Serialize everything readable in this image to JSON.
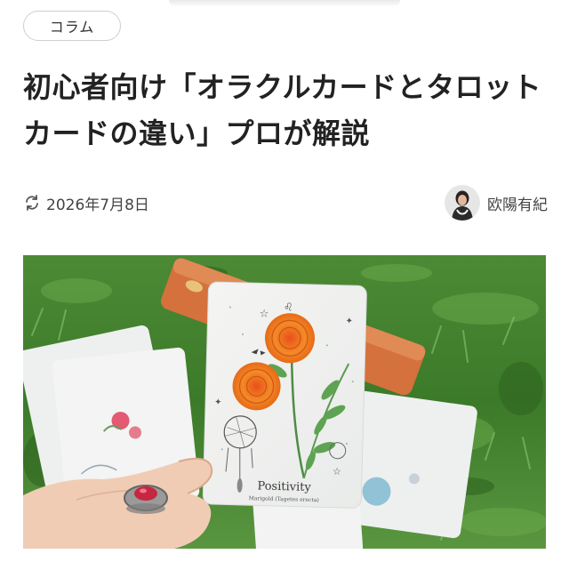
{
  "category": {
    "label": "コラム"
  },
  "article": {
    "title": "初心者向け「オラクルカードとタロットカードの違い」プロが解説",
    "updated_date": "2026年7月8日",
    "author_name": "欧陽有紀"
  },
  "hero_card": {
    "title": "Positivity",
    "subtitle": "Marigold (Tagetes erecta)"
  },
  "icons": {
    "refresh": "refresh-icon",
    "avatar": "author-avatar"
  },
  "colors": {
    "text": "#222222",
    "muted": "#444444",
    "chip_border": "#cfcfcf",
    "grass": "#3f7d2c",
    "marigold": "#f07f1f"
  }
}
